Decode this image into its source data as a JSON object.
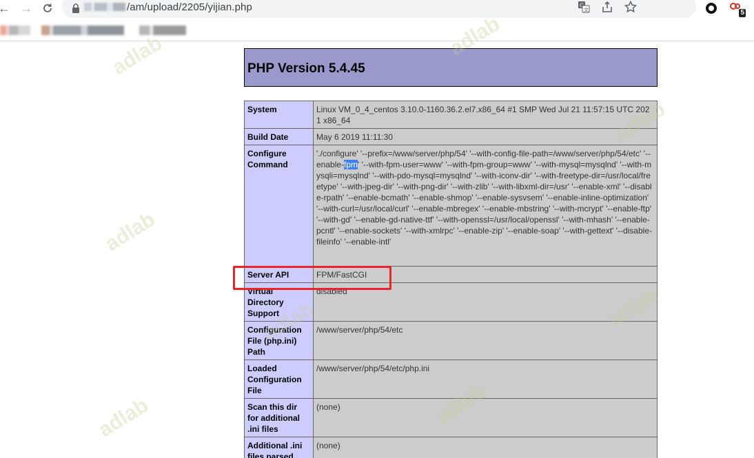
{
  "browser": {
    "url_path": "/am/upload/2205/yijian.php",
    "extension_badge": "5"
  },
  "page": {
    "title": "PHP Version 5.4.45"
  },
  "rows": [
    {
      "key": "System",
      "value": "Linux VM_0_4_centos 3.10.0-1160.36.2.el7.x86_64 #1 SMP Wed Jul 21 11:57:15 UTC 2021 x86_64"
    },
    {
      "key": "Build Date",
      "value": "May 6 2019 11:11:30"
    },
    {
      "key": "Configure Command",
      "value_pre": "'./configure' '--prefix=/www/server/php/54' '--with-config-file-path=/www/server/php/54/etc' '--enable-",
      "value_highlight": "fpm",
      "value_post": "' '--with-fpm-user=www' '--with-fpm-group=www' '--with-mysql=mysqlnd' '--with-mysqli=mysqlnd' '--with-pdo-mysql=mysqlnd' '--with-iconv-dir' '--with-freetype-dir=/usr/local/freetype' '--with-jpeg-dir' '--with-png-dir' '--with-zlib' '--with-libxml-dir=/usr' '--enable-xml' '--disable-rpath' '--enable-bcmath' '--enable-shmop' '--enable-sysvsem' '--enable-inline-optimization' '--with-curl=/usr/local/curl' '--enable-mbregex' '--enable-mbstring' '--with-mcrypt' '--enable-ftp' '--with-gd' '--enable-gd-native-ttf' '--with-openssl=/usr/local/openssl' '--with-mhash' '--enable-pcntl' '--enable-sockets' '--with-xmlrpc' '--enable-zip' '--enable-soap' '--with-gettext' '--disable-fileinfo' '--enable-intl'"
    },
    {
      "key": "Server API",
      "value": "FPM/FastCGI"
    },
    {
      "key": "Virtual Directory Support",
      "value": "disabled"
    },
    {
      "key": "Configuration File (php.ini) Path",
      "value": "/www/server/php/54/etc"
    },
    {
      "key": "Loaded Configuration File",
      "value": "/www/server/php/54/etc/php.ini"
    },
    {
      "key": "Scan this dir for additional .ini files",
      "value": "(none)"
    },
    {
      "key": "Additional .ini files parsed",
      "value": "(none)"
    }
  ],
  "watermark_text": "adlab",
  "colors": {
    "header_bg": "#9999cc",
    "key_cell_bg": "#ccccff",
    "value_cell_bg": "#cccccc",
    "highlight_box": "#e8262a"
  }
}
